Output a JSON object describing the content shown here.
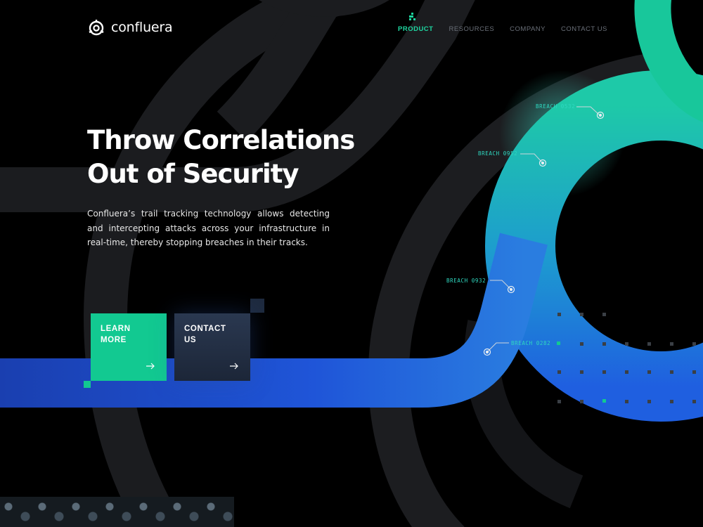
{
  "brand": {
    "name": "confluera"
  },
  "nav": {
    "items": [
      {
        "label": "PRODUCT",
        "active": true
      },
      {
        "label": "RESOURCES",
        "active": false
      },
      {
        "label": "COMPANY",
        "active": false
      },
      {
        "label": "CONTACT US",
        "active": false
      }
    ]
  },
  "hero": {
    "title_line1": "Throw Correlations",
    "title_line2": "Out of Security",
    "description": "Confluera’s trail tracking technology allows detecting and intercepting attacks across your infrastructure in real-time, thereby stopping breaches in their tracks."
  },
  "buttons": {
    "learn_more": "LEARN\nMORE",
    "contact_us": "CONTACT\nUS"
  },
  "breaches": [
    {
      "label": "BREACH 0532"
    },
    {
      "label": "BREACH 0952"
    },
    {
      "label": "BREACH 0932"
    },
    {
      "label": "BREACH 0282"
    }
  ],
  "colors": {
    "accent_green": "#12c991",
    "accent_teal": "#2fd8c0",
    "accent_blue": "#1f5fe0",
    "background": "#000000",
    "track_gray": "#1e1f22"
  },
  "icons": {
    "logo": "confluera-logo-icon",
    "nav_indicator": "product-indicator-icon",
    "arrow": "arrow-right-icon",
    "marker": "breach-marker-icon"
  }
}
